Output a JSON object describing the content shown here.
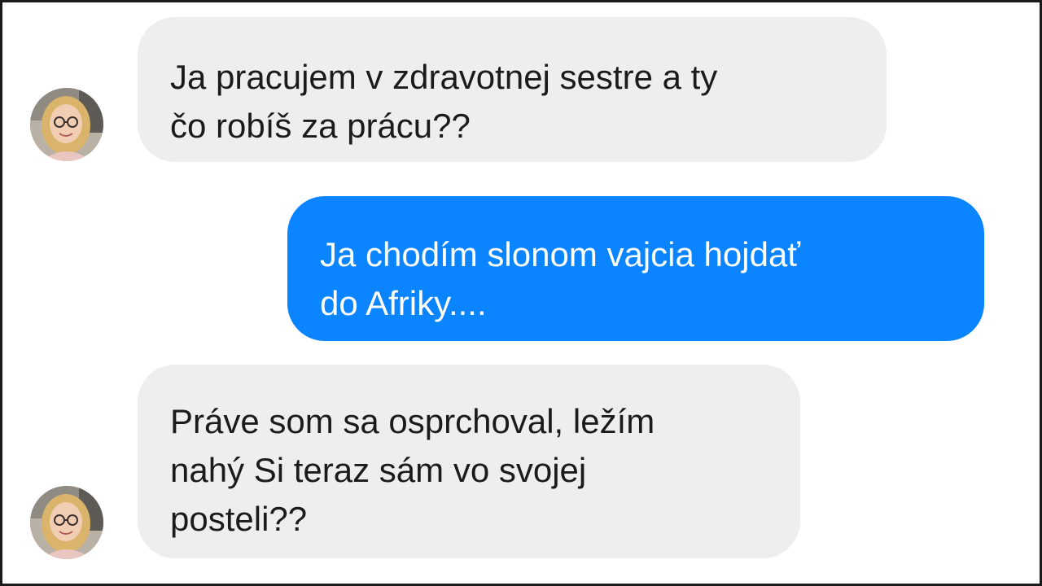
{
  "conversation": {
    "messages": [
      {
        "sender": "contact",
        "lines": [
          "Ja pracujem v zdravotnej sestre a ty",
          "čo robíš za prácu??"
        ]
      },
      {
        "sender": "me",
        "lines": [
          "Ja chodím slonom vajcia hojdať",
          "do Afriky...."
        ]
      },
      {
        "sender": "contact",
        "lines": [
          "Práve som sa osprchoval, ležím",
          "nahý Si teraz sám vo svojej",
          "posteli??"
        ]
      }
    ]
  },
  "colors": {
    "incoming_bubble": "#eeeeee",
    "outgoing_bubble": "#0a84ff",
    "incoming_text": "#1b1b1b",
    "outgoing_text": "#ffffff"
  }
}
